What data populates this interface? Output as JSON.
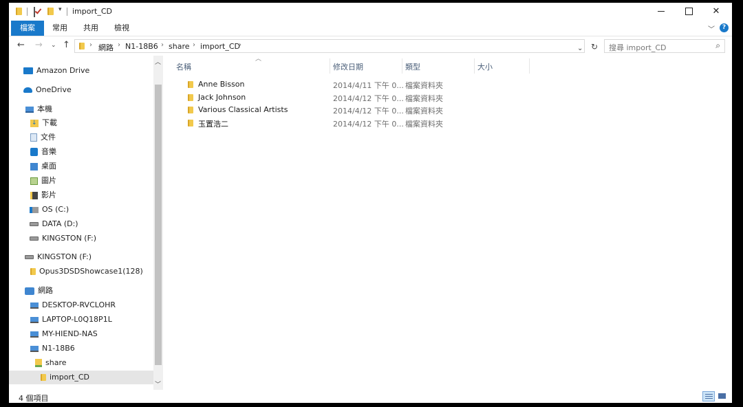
{
  "window": {
    "title": "import_CD",
    "min_label": "",
    "max_label": "",
    "close_label": "✕"
  },
  "ribbon": {
    "tabs": [
      {
        "label": "檔案"
      },
      {
        "label": "常用"
      },
      {
        "label": "共用"
      },
      {
        "label": "檢視"
      }
    ],
    "help": "?"
  },
  "address": {
    "crumbs": [
      "網路",
      "N1-18B6",
      "share",
      "import_CD"
    ],
    "search_placeholder": "搜尋 import_CD"
  },
  "navpane": {
    "items": [
      {
        "label": "Amazon Drive",
        "icon": "amazon-drive-icon"
      },
      {
        "label": "OneDrive",
        "icon": "onedrive-icon"
      },
      {
        "label": "本機",
        "icon": "this-pc-icon"
      },
      {
        "label": "下載",
        "icon": "downloads-icon"
      },
      {
        "label": "文件",
        "icon": "documents-icon"
      },
      {
        "label": "音樂",
        "icon": "music-icon"
      },
      {
        "label": "桌面",
        "icon": "desktop-icon"
      },
      {
        "label": "圖片",
        "icon": "pictures-icon"
      },
      {
        "label": "影片",
        "icon": "videos-icon"
      },
      {
        "label": "OS (C:)",
        "icon": "os-drive-icon"
      },
      {
        "label": "DATA (D:)",
        "icon": "drive-icon"
      },
      {
        "label": "KINGSTON (F:)",
        "icon": "usb-drive-icon"
      },
      {
        "label": "KINGSTON (F:)",
        "icon": "usb-drive-icon"
      },
      {
        "label": "Opus3DSDShowcase1(128)",
        "icon": "folder-icon"
      },
      {
        "label": "網路",
        "icon": "network-icon"
      },
      {
        "label": "DESKTOP-RVCLOHR",
        "icon": "computer-icon"
      },
      {
        "label": "LAPTOP-L0Q18P1L",
        "icon": "computer-icon"
      },
      {
        "label": "MY-HIEND-NAS",
        "icon": "computer-icon"
      },
      {
        "label": "N1-18B6",
        "icon": "computer-icon"
      },
      {
        "label": "share",
        "icon": "shared-folder-icon"
      },
      {
        "label": "import_CD",
        "icon": "folder-icon",
        "selected": true
      }
    ]
  },
  "content": {
    "columns": [
      "名稱",
      "修改日期",
      "類型",
      "大小"
    ],
    "rows": [
      {
        "name": "Anne Bisson",
        "date": "2014/4/11 下午 0...",
        "type": "檔案資料夾",
        "size": ""
      },
      {
        "name": "Jack Johnson",
        "date": "2014/4/12 下午 0...",
        "type": "檔案資料夾",
        "size": ""
      },
      {
        "name": "Various Classical Artists",
        "date": "2014/4/12 下午 0...",
        "type": "檔案資料夾",
        "size": ""
      },
      {
        "name": "玉置浩二",
        "date": "2014/4/12 下午 0...",
        "type": "檔案資料夾",
        "size": ""
      }
    ]
  },
  "status": {
    "count": "4 個項目"
  },
  "colors": {
    "accent": "#1979ca",
    "folder": "#f2c94c",
    "selected_bg": "#e5e5e5"
  }
}
